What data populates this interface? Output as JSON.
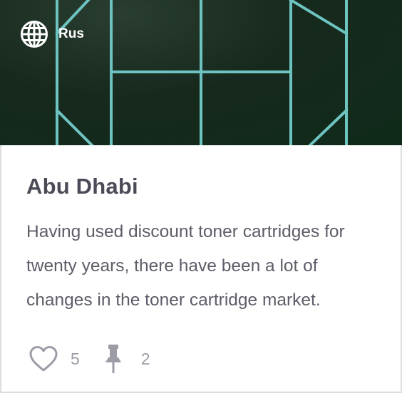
{
  "card": {
    "language": "Rus",
    "title": "Abu Dhabi",
    "description": "Having used discount toner cartridges for twenty years, there have been a lot of changes in the toner cartridge market.",
    "likes": "5",
    "pins": "2"
  },
  "icons": {
    "language": "globe-icon",
    "like": "heart-icon",
    "pin": "pushpin-icon"
  },
  "colors": {
    "hero_background": "#0f2a1a",
    "pattern_line": "#6cc3bf",
    "title": "#4a4b57",
    "text": "#5c5d68",
    "muted": "#9c9ca6"
  }
}
